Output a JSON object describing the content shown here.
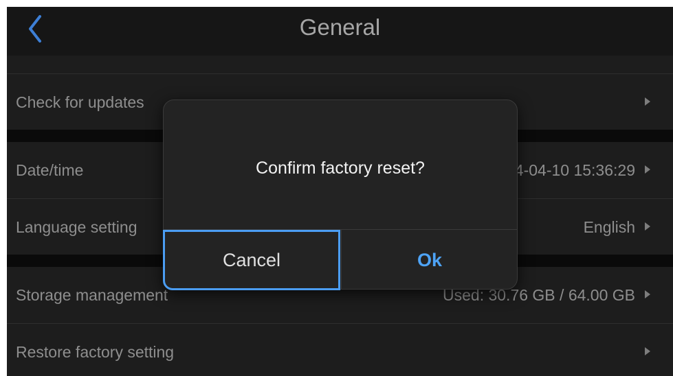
{
  "header": {
    "title": "General",
    "back_icon": "chevron-left-icon",
    "accent_color": "#4b9df3"
  },
  "settings": {
    "rows": [
      {
        "label": "Check for updates",
        "value": ""
      },
      {
        "label": "Date/time",
        "value": "2024-04-10 15:36:29"
      },
      {
        "label": "Language setting",
        "value": "English"
      },
      {
        "label": "Storage management",
        "value": "Used: 30.76 GB / 64.00 GB"
      },
      {
        "label": "Restore factory setting",
        "value": ""
      }
    ]
  },
  "dialog": {
    "message": "Confirm factory reset?",
    "cancel_label": "Cancel",
    "ok_label": "Ok",
    "focused_button": "cancel"
  }
}
